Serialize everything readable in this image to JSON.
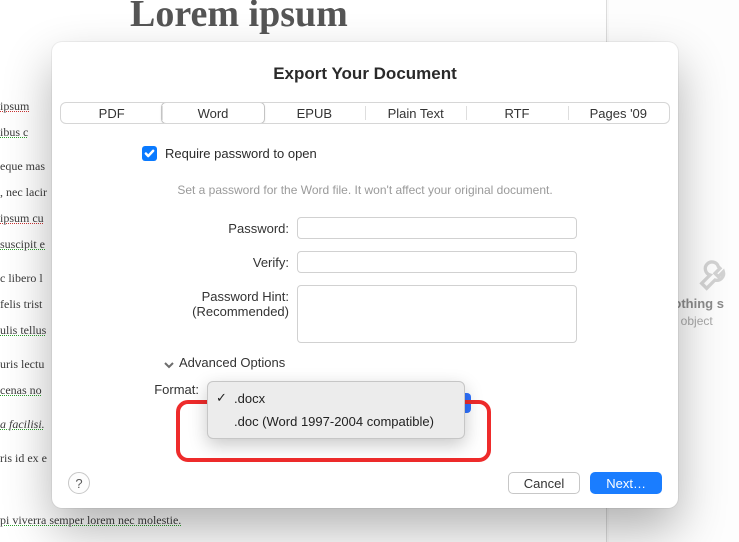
{
  "bg": {
    "title": "Lorem ipsum",
    "lines": [
      {
        "t": "ipsum",
        "cls": "ul-red"
      },
      {
        "t": "ibus c",
        "cls": "ul-green"
      },
      {
        "t": "eque mas",
        "cls": ""
      },
      {
        "t": ", nec lacir",
        "cls": ""
      },
      {
        "t": "ipsum cu",
        "cls": "ul-red"
      },
      {
        "t": "suscipit e",
        "cls": "ul-green"
      },
      {
        "t": "c libero l",
        "cls": ""
      },
      {
        "t": "felis trist",
        "cls": ""
      },
      {
        "t": "ulis tellus",
        "cls": "ul-green"
      },
      {
        "t": "uris lectu",
        "cls": ""
      },
      {
        "t": "cenas no",
        "cls": "ul-green"
      },
      {
        "t": "a facilisi.",
        "cls": "italic ul-green"
      },
      {
        "t": "ris id ex e",
        "cls": ""
      }
    ],
    "bottom": "pi viverra semper lorem nec molestie."
  },
  "sidebar": {
    "text1": "Nothing s",
    "text2": "an object"
  },
  "modal": {
    "title": "Export Your Document",
    "tabs": [
      "PDF",
      "Word",
      "EPUB",
      "Plain Text",
      "RTF",
      "Pages '09"
    ],
    "active_tab_index": 1,
    "require_pw_label": "Require password to open",
    "require_pw_checked": true,
    "hint": "Set a password for the Word file. It won't affect your original document.",
    "labels": {
      "password": "Password:",
      "verify": "Verify:",
      "hint1": "Password Hint:",
      "hint2": "(Recommended)",
      "advanced": "Advanced Options",
      "format": "Format:"
    },
    "format_options": [
      {
        "label": ".docx",
        "selected": true
      },
      {
        "label": ".doc (Word 1997-2004 compatible)",
        "selected": false
      }
    ],
    "buttons": {
      "help": "?",
      "cancel": "Cancel",
      "next": "Next…"
    }
  }
}
